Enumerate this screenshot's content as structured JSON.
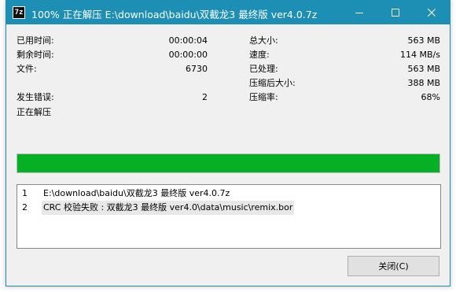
{
  "window": {
    "title": "100% 正在解压 E:\\download\\baidu\\双截龙3 最终版 ver4.0.7z",
    "app_icon_text": "7z"
  },
  "stats_left": [
    {
      "label": "已用时间:",
      "value": "00:00:04"
    },
    {
      "label": "剩余时间:",
      "value": "00:00:00"
    },
    {
      "label": "文件:",
      "value": "6730"
    },
    {
      "label": "发生错误:",
      "value": "2"
    }
  ],
  "stats_right": [
    {
      "label": "总大小:",
      "value": "563 MB"
    },
    {
      "label": "速度:",
      "value": "114 MB/s"
    },
    {
      "label": "已处理:",
      "value": "563 MB"
    },
    {
      "label": "压缩后大小:",
      "value": "388 MB"
    },
    {
      "label": "压缩率:",
      "value": "68%"
    }
  ],
  "status_text": "正在解压",
  "progress": {
    "percent": 100,
    "color": "#06b025"
  },
  "log": [
    {
      "num": "1",
      "text": "E:\\download\\baidu\\双截龙3 最终版 ver4.0.7z"
    },
    {
      "num": "2",
      "text": "CRC 校验失败 : 双截龙3 最终版 ver4.0\\data\\music\\remix.bor"
    }
  ],
  "close_button_label": "关闭(C)",
  "icons": {
    "minimize": "minimize-icon",
    "maximize": "maximize-icon",
    "close": "close-icon"
  },
  "colors": {
    "titlebar": "#1e8fb4",
    "progress": "#06b025"
  }
}
